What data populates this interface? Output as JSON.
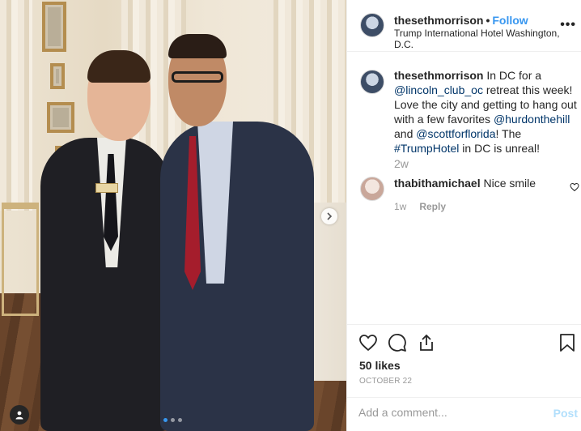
{
  "post": {
    "username": "thesethmorrison",
    "separator": "•",
    "follow_label": "Follow",
    "location": "Trump International Hotel Washington, D.C.",
    "more_label": "•••"
  },
  "caption": {
    "username": "thesethmorrison",
    "text_1": " In DC for a ",
    "mention_1": "@lincoln_club_oc",
    "text_2": " retreat this week! Love the city and getting to hang out with a few favorites ",
    "mention_2": "@hurdonthehill",
    "text_3": " and ",
    "mention_3": "@scottforflorida",
    "text_4": "! The ",
    "hashtag": "#TrumpHotel",
    "text_5": " in DC is unreal!",
    "time": "2w"
  },
  "comments": [
    {
      "username": "thabithamichael",
      "text": "Nice smile",
      "time": "1w",
      "reply_label": "Reply"
    }
  ],
  "actions": {
    "likes": "50 likes",
    "date": "OCTOBER 22"
  },
  "add_comment": {
    "placeholder": "Add a comment...",
    "post_label": "Post"
  },
  "carousel": {
    "total": 3,
    "active_index": 0
  },
  "colors": {
    "link": "#3897f0",
    "mention": "#003569",
    "muted": "#999999"
  },
  "icons": [
    "chevron-right-icon",
    "user-tag-icon",
    "heart-icon",
    "comment-icon",
    "share-icon",
    "bookmark-icon"
  ]
}
